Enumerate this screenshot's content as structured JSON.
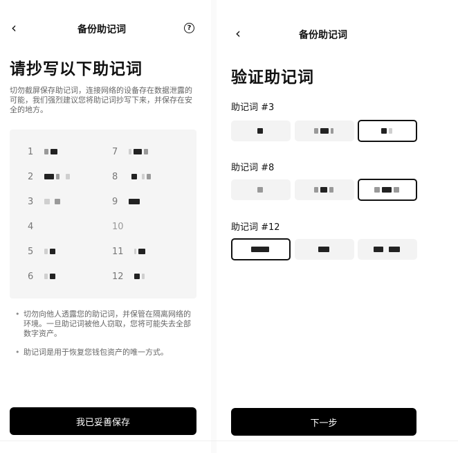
{
  "left": {
    "nav": {
      "back_icon": "‹",
      "title": "备份助记词",
      "help_icon": "?"
    },
    "heading": "请抄写以下助记词",
    "description": "切勿截屏保存助记词，连接网络的设备存在数据泄露的可能，我们强烈建议您将助记词抄写下来，并保存在安全的地方。",
    "words": [
      {
        "num": "1"
      },
      {
        "num": "2"
      },
      {
        "num": "3"
      },
      {
        "num": "4"
      },
      {
        "num": "5"
      },
      {
        "num": "6"
      },
      {
        "num": "7"
      },
      {
        "num": "8"
      },
      {
        "num": "9"
      },
      {
        "num": "10"
      },
      {
        "num": "11"
      },
      {
        "num": "12"
      }
    ],
    "tips": [
      "切勿向他人透露您的助记词，并保管在隔离网络的环境。一旦助记词被他人窃取，您将可能失去全部数字资产。",
      "助记词是用于恢复您钱包资产的唯一方式。"
    ],
    "button": "我已妥善保存"
  },
  "right": {
    "nav": {
      "back_icon": "‹",
      "title": "备份助记词"
    },
    "heading": "验证助记词",
    "groups": [
      {
        "label": "助记词 #3",
        "selected_index": 2
      },
      {
        "label": "助记词 #8",
        "selected_index": 2
      },
      {
        "label": "助记词 #12",
        "selected_index": 0
      }
    ],
    "button": "下一步"
  },
  "colors": {
    "primary": "#000000",
    "panel_bg": "#f5f5f5",
    "text_secondary": "#666666"
  }
}
